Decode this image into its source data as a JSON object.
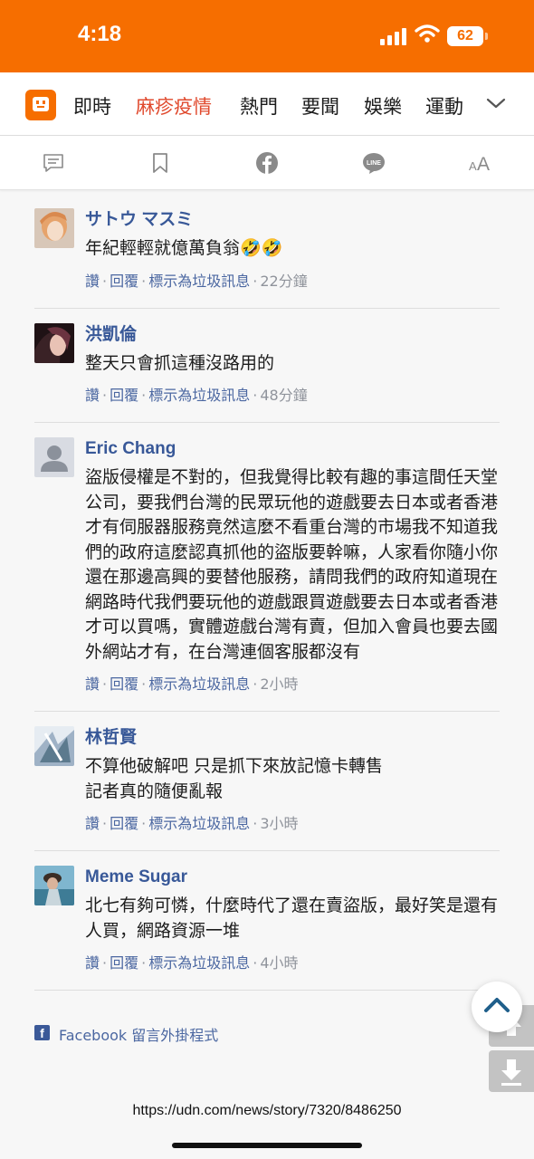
{
  "status_bar": {
    "time": "4:18",
    "battery": "62"
  },
  "nav": {
    "tabs": [
      {
        "label": "即時",
        "active": false
      },
      {
        "label": "麻疹疫情",
        "active": true
      },
      {
        "label": "熱門",
        "active": false
      },
      {
        "label": "要聞",
        "active": false
      },
      {
        "label": "娛樂",
        "active": false
      },
      {
        "label": "運動",
        "active": false
      }
    ]
  },
  "toolbar": {
    "icons": [
      "comment-icon",
      "bookmark-icon",
      "facebook-icon",
      "line-icon",
      "font-size-icon"
    ],
    "line_label": "LINE",
    "font_label_small": "A",
    "font_label_large": "A"
  },
  "comment_actions": {
    "like": "讚",
    "reply": "回覆",
    "spam": "標示為垃圾訊息"
  },
  "comments": [
    {
      "name": "サトウ マスミ",
      "text": "年紀輕輕就億萬負翁🤣🤣",
      "time": "22分鐘"
    },
    {
      "name": "洪凱倫",
      "text": "整天只會抓這種沒路用的",
      "time": "48分鐘"
    },
    {
      "name": "Eric Chang",
      "text": "盜版侵權是不對的，但我覺得比較有趣的事這間任天堂公司，要我們台灣的民眾玩他的遊戲要去日本或者香港才有伺服器服務竟然這麼不看重台灣的市場我不知道我們的政府這麼認真抓他的盜版要幹嘛，人家看你隨小你還在那邊高興的要替他服務，請問我們的政府知道現在網路時代我們要玩他的遊戲跟買遊戲要去日本或者香港才可以買嗎，實體遊戲台灣有賣，但加入會員也要去國外網站才有，在台灣連個客服都沒有",
      "time": "2小時"
    },
    {
      "name": "林哲賢",
      "text": "不算他破解吧 只是抓下來放記憶卡轉售\n記者真的隨便亂報",
      "time": "3小時"
    },
    {
      "name": "Meme Sugar",
      "text": "北七有夠可憐，什麼時代了還在賣盜版，最好笑是還有人買，網路資源一堆",
      "time": "4小時"
    }
  ],
  "fb_plugin": {
    "icon_letter": "f",
    "label": "Facebook 留言外掛程式"
  },
  "url": "https://udn.com/news/story/7320/8486250",
  "colors": {
    "brand": "#f66e00",
    "active_tab": "#e0492d",
    "fb_name": "#385898",
    "link": "#4b67a1",
    "meta": "#90949c"
  }
}
